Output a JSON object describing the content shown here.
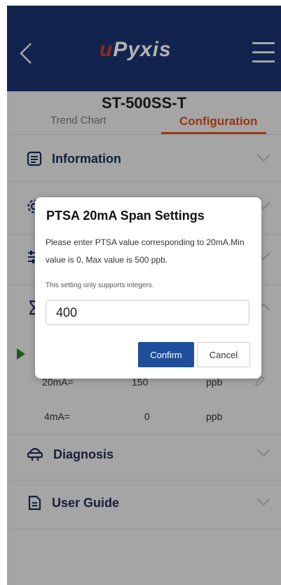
{
  "header": {
    "logo_u": "u",
    "logo_rest": "Pyxis"
  },
  "device": {
    "title": "ST-500SS-T"
  },
  "tabs": [
    {
      "label": "Trend Chart"
    },
    {
      "label": "Configuration"
    }
  ],
  "sections": {
    "information": "Information",
    "diagnosis": "Diagnosis",
    "user_guide": "User Guide"
  },
  "settings": {
    "row_20ma": {
      "label": "20mA=",
      "value": "150",
      "unit": "ppb"
    },
    "row_4ma": {
      "label": "4mA=",
      "value": "0",
      "unit": "ppb"
    }
  },
  "dialog": {
    "title": "PTSA 20mA Span Settings",
    "description": "Please enter PTSA value corresponding to 20mA.Min value is 0, Max value is 500 ppb.",
    "note": "This setting only supports integers.",
    "input_value": "400",
    "confirm_label": "Confirm",
    "cancel_label": "Cancel"
  },
  "colors": {
    "header_bg": "#1a3470",
    "accent": "#d8501d",
    "confirm_bg": "#1f4f98"
  },
  "icons": [
    "back-arrow-icon",
    "menu-icon",
    "document-icon",
    "gear-icon",
    "sliders-icon",
    "hourglass-icon",
    "play-icon",
    "diagnosis-icon",
    "user-guide-icon",
    "chevron-down-icon",
    "chevron-up-icon",
    "edit-icon"
  ]
}
